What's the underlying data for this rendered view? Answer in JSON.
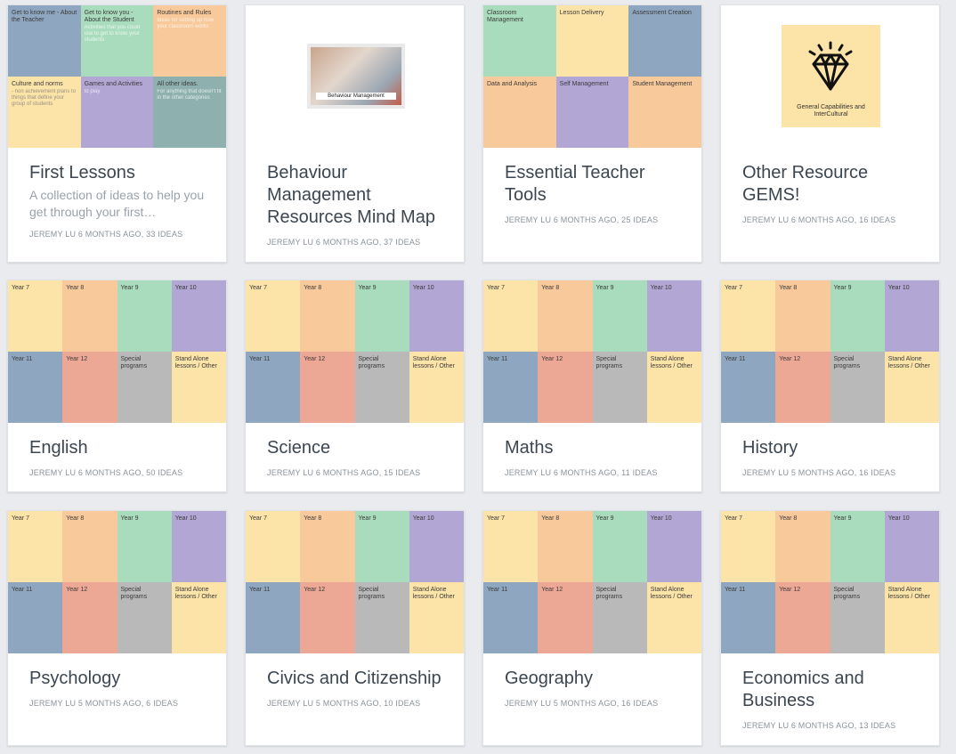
{
  "boards": [
    {
      "title": "First Lessons",
      "description": "A collection of ideas to help you get through your first…",
      "meta": "JEREMY LU 6 MONTHS AGO, 33 IDEAS",
      "tiles": [
        {
          "label": "Get to know me - About the Teacher",
          "sub": ""
        },
        {
          "label": "Get to know you - About the Student",
          "sub": "Activities that you could use to get to know your students"
        },
        {
          "label": "Routines and Rules",
          "sub": "Ideas for setting up how your classroom works"
        },
        {
          "label": "Culture and norms",
          "sub": "- non achievement plans to things that define your group of students"
        },
        {
          "label": "Games and Activities",
          "sub": "to play"
        },
        {
          "label": "All other ideas.",
          "sub": "For anything that doesn't fit in the other categories"
        }
      ]
    },
    {
      "title": "Behaviour Management Resources Mind Map",
      "description": "",
      "meta": "JEREMY LU 6 MONTHS AGO, 37 IDEAS",
      "image_caption": "Behaviour Management"
    },
    {
      "title": "Essential Teacher Tools",
      "description": "",
      "meta": "JEREMY LU 6 MONTHS AGO, 25 IDEAS",
      "tiles": [
        {
          "label": "Classroom Management",
          "sub": ""
        },
        {
          "label": "Lesson Delivery",
          "sub": ""
        },
        {
          "label": "Assessment Creation",
          "sub": ""
        },
        {
          "label": "Data and Analysis",
          "sub": ""
        },
        {
          "label": "Self Management",
          "sub": ""
        },
        {
          "label": "Student Management",
          "sub": ""
        }
      ]
    },
    {
      "title": "Other Resource GEMS!",
      "description": "",
      "meta": "JEREMY LU 6 MONTHS AGO, 16 IDEAS",
      "gems_caption": "General Capabilities and InterCultural"
    },
    {
      "title": "English",
      "meta": "JEREMY LU 6 MONTHS AGO, 50 IDEAS"
    },
    {
      "title": "Science",
      "meta": "JEREMY LU 6 MONTHS AGO, 15 IDEAS"
    },
    {
      "title": "Maths",
      "meta": "JEREMY LU 6 MONTHS AGO, 11 IDEAS"
    },
    {
      "title": "History",
      "meta": "JEREMY LU 5 MONTHS AGO, 16 IDEAS"
    },
    {
      "title": "Psychology",
      "meta": "JEREMY LU 5 MONTHS AGO, 6 IDEAS"
    },
    {
      "title": "Civics and Citizenship",
      "meta": "JEREMY LU 5 MONTHS AGO, 10 IDEAS"
    },
    {
      "title": "Geography",
      "meta": "JEREMY LU 5 MONTHS AGO, 16 IDEAS"
    },
    {
      "title": "Economics and Business",
      "meta": "JEREMY LU 6 MONTHS AGO, 13 IDEAS"
    }
  ],
  "year_tiles": [
    "Year 7",
    "Year 8",
    "Year 9",
    "Year 10",
    "Year 11",
    "Year 12",
    "Special programs",
    "Stand Alone lessons / Other"
  ],
  "colors": {
    "yellow": "#fce3a8",
    "orange": "#f8c99a",
    "green": "#a9dcbc",
    "purple": "#b1a6d4",
    "blue": "#8ea6c0",
    "red": "#eda795",
    "grey": "#b9b9b9",
    "teal": "#8eb1b0"
  }
}
